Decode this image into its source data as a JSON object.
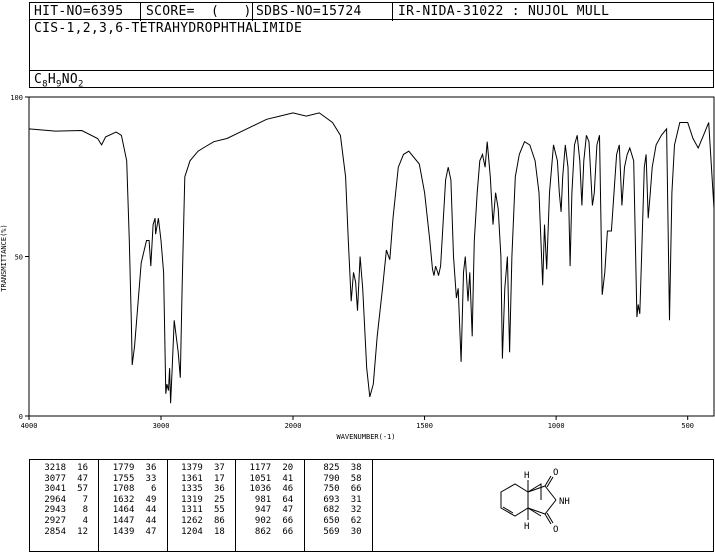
{
  "header": {
    "hit_no": "HIT-NO=6395",
    "score": "SCORE=  (   )",
    "sdbs_no": "SDBS-NO=15724",
    "ir_info": "IR-NIDA-31022 : NUJOL MULL"
  },
  "compound": {
    "name": "CIS-1,2,3,6-TETRAHYDROPHTHALIMIDE",
    "formula": "C8H9NO2"
  },
  "chart_data": {
    "type": "line",
    "xlabel": "WAVENUMBER(-1)",
    "ylabel": "TRANSMITTANCE(%)",
    "xlim": [
      4000,
      400
    ],
    "ylim": [
      0,
      100
    ],
    "x_ticks": [
      "4000",
      "3000",
      "2000",
      "1500",
      "1000",
      "500"
    ],
    "y_ticks": [
      "100",
      "50",
      "0"
    ],
    "line_color": "#000000",
    "spectrum": [
      [
        4000,
        90
      ],
      [
        3800,
        89.3
      ],
      [
        3600,
        89.5
      ],
      [
        3480,
        87
      ],
      [
        3450,
        85
      ],
      [
        3420,
        87.5
      ],
      [
        3340,
        89
      ],
      [
        3300,
        88
      ],
      [
        3260,
        80
      ],
      [
        3240,
        55
      ],
      [
        3225,
        30
      ],
      [
        3218,
        16
      ],
      [
        3200,
        22
      ],
      [
        3150,
        48
      ],
      [
        3110,
        55
      ],
      [
        3090,
        55
      ],
      [
        3077,
        47
      ],
      [
        3060,
        60
      ],
      [
        3045,
        62
      ],
      [
        3041,
        57
      ],
      [
        3020,
        62
      ],
      [
        3000,
        55
      ],
      [
        2980,
        45
      ],
      [
        2964,
        7
      ],
      [
        2955,
        10
      ],
      [
        2943,
        8
      ],
      [
        2935,
        15
      ],
      [
        2927,
        4
      ],
      [
        2915,
        15
      ],
      [
        2900,
        30
      ],
      [
        2885,
        25
      ],
      [
        2870,
        20
      ],
      [
        2854,
        12
      ],
      [
        2840,
        40
      ],
      [
        2820,
        75
      ],
      [
        2780,
        80
      ],
      [
        2720,
        83
      ],
      [
        2680,
        84
      ],
      [
        2600,
        86
      ],
      [
        2500,
        87
      ],
      [
        2400,
        89
      ],
      [
        2300,
        91
      ],
      [
        2200,
        93
      ],
      [
        2100,
        94
      ],
      [
        2000,
        95
      ],
      [
        1950,
        94
      ],
      [
        1900,
        95
      ],
      [
        1850,
        92
      ],
      [
        1820,
        88
      ],
      [
        1800,
        75
      ],
      [
        1790,
        55
      ],
      [
        1779,
        36
      ],
      [
        1770,
        45
      ],
      [
        1762,
        42
      ],
      [
        1755,
        33
      ],
      [
        1745,
        50
      ],
      [
        1735,
        40
      ],
      [
        1720,
        15
      ],
      [
        1708,
        6
      ],
      [
        1695,
        10
      ],
      [
        1680,
        25
      ],
      [
        1660,
        40
      ],
      [
        1645,
        52
      ],
      [
        1632,
        49
      ],
      [
        1620,
        62
      ],
      [
        1600,
        78
      ],
      [
        1580,
        82
      ],
      [
        1560,
        83
      ],
      [
        1520,
        79
      ],
      [
        1500,
        70
      ],
      [
        1480,
        55
      ],
      [
        1470,
        46
      ],
      [
        1464,
        44
      ],
      [
        1458,
        47
      ],
      [
        1450,
        45
      ],
      [
        1447,
        44
      ],
      [
        1439,
        47
      ],
      [
        1430,
        60
      ],
      [
        1420,
        74
      ],
      [
        1410,
        78
      ],
      [
        1400,
        74
      ],
      [
        1390,
        50
      ],
      [
        1379,
        37
      ],
      [
        1372,
        40
      ],
      [
        1361,
        17
      ],
      [
        1352,
        45
      ],
      [
        1345,
        50
      ],
      [
        1335,
        36
      ],
      [
        1328,
        45
      ],
      [
        1319,
        25
      ],
      [
        1315,
        40
      ],
      [
        1311,
        55
      ],
      [
        1300,
        70
      ],
      [
        1290,
        80
      ],
      [
        1280,
        82
      ],
      [
        1270,
        78
      ],
      [
        1262,
        86
      ],
      [
        1250,
        75
      ],
      [
        1240,
        60
      ],
      [
        1230,
        70
      ],
      [
        1220,
        65
      ],
      [
        1210,
        50
      ],
      [
        1204,
        18
      ],
      [
        1195,
        40
      ],
      [
        1185,
        50
      ],
      [
        1177,
        20
      ],
      [
        1168,
        50
      ],
      [
        1155,
        75
      ],
      [
        1140,
        82
      ],
      [
        1120,
        86
      ],
      [
        1100,
        85
      ],
      [
        1080,
        80
      ],
      [
        1065,
        70
      ],
      [
        1051,
        41
      ],
      [
        1044,
        60
      ],
      [
        1036,
        46
      ],
      [
        1025,
        70
      ],
      [
        1010,
        85
      ],
      [
        995,
        80
      ],
      [
        988,
        70
      ],
      [
        981,
        64
      ],
      [
        975,
        75
      ],
      [
        965,
        85
      ],
      [
        955,
        78
      ],
      [
        947,
        47
      ],
      [
        940,
        70
      ],
      [
        930,
        85
      ],
      [
        920,
        88
      ],
      [
        910,
        80
      ],
      [
        902,
        66
      ],
      [
        895,
        80
      ],
      [
        885,
        88
      ],
      [
        875,
        86
      ],
      [
        862,
        66
      ],
      [
        855,
        70
      ],
      [
        845,
        85
      ],
      [
        835,
        88
      ],
      [
        825,
        38
      ],
      [
        815,
        45
      ],
      [
        805,
        58
      ],
      [
        790,
        58
      ],
      [
        780,
        70
      ],
      [
        770,
        82
      ],
      [
        760,
        85
      ],
      [
        750,
        66
      ],
      [
        740,
        78
      ],
      [
        730,
        82
      ],
      [
        720,
        84
      ],
      [
        705,
        80
      ],
      [
        693,
        31
      ],
      [
        688,
        35
      ],
      [
        682,
        32
      ],
      [
        675,
        50
      ],
      [
        665,
        78
      ],
      [
        658,
        82
      ],
      [
        650,
        62
      ],
      [
        642,
        70
      ],
      [
        635,
        78
      ],
      [
        620,
        85
      ],
      [
        600,
        88
      ],
      [
        580,
        90
      ],
      [
        569,
        30
      ],
      [
        560,
        70
      ],
      [
        550,
        85
      ],
      [
        530,
        92
      ],
      [
        500,
        92
      ],
      [
        480,
        87
      ],
      [
        460,
        84
      ],
      [
        440,
        88
      ],
      [
        420,
        92
      ],
      [
        400,
        65
      ]
    ]
  },
  "peak_table": [
    [
      [
        "3218",
        "16"
      ],
      [
        "3077",
        "47"
      ],
      [
        "3041",
        "57"
      ],
      [
        "2964",
        "7"
      ],
      [
        "2943",
        "8"
      ],
      [
        "2927",
        "4"
      ],
      [
        "2854",
        "12"
      ]
    ],
    [
      [
        "1779",
        "36"
      ],
      [
        "1755",
        "33"
      ],
      [
        "1708",
        "6"
      ],
      [
        "1632",
        "49"
      ],
      [
        "1464",
        "44"
      ],
      [
        "1447",
        "44"
      ],
      [
        "1439",
        "47"
      ]
    ],
    [
      [
        "1379",
        "37"
      ],
      [
        "1361",
        "17"
      ],
      [
        "1335",
        "36"
      ],
      [
        "1319",
        "25"
      ],
      [
        "1311",
        "55"
      ],
      [
        "1262",
        "86"
      ],
      [
        "1204",
        "18"
      ]
    ],
    [
      [
        "1177",
        "20"
      ],
      [
        "1051",
        "41"
      ],
      [
        "1036",
        "46"
      ],
      [
        "981",
        "64"
      ],
      [
        "947",
        "47"
      ],
      [
        "902",
        "66"
      ],
      [
        "862",
        "66"
      ]
    ],
    [
      [
        "825",
        "38"
      ],
      [
        "790",
        "58"
      ],
      [
        "750",
        "66"
      ],
      [
        "693",
        "31"
      ],
      [
        "682",
        "32"
      ],
      [
        "650",
        "62"
      ],
      [
        "569",
        "30"
      ]
    ]
  ],
  "structure": {
    "labels": [
      "H",
      "O",
      "NH",
      "H",
      "O"
    ]
  }
}
